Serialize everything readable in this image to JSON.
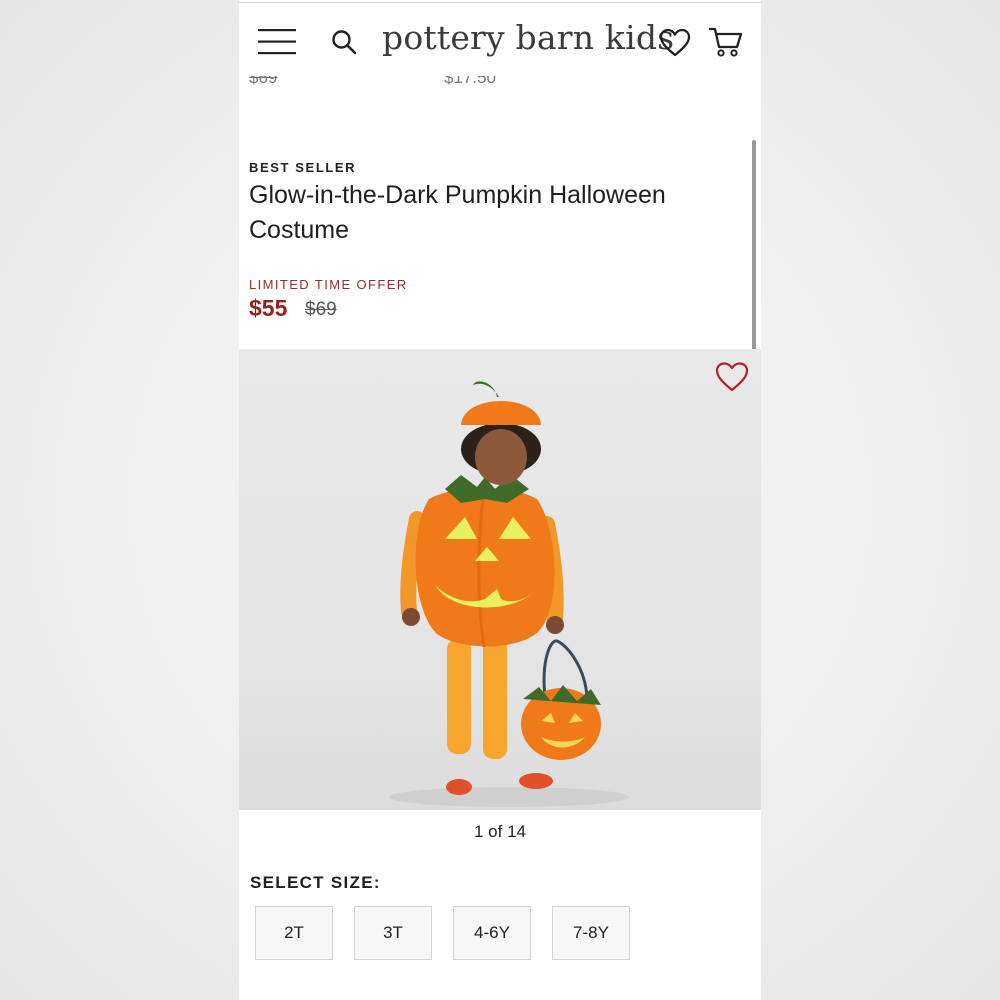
{
  "header": {
    "logo": "pottery barn kids",
    "icons": {
      "menu": "menu-icon",
      "search": "search-icon",
      "wishlist": "heart-icon",
      "cart": "cart-icon"
    }
  },
  "previous_row": {
    "price_left": "$69",
    "price_right": "$17.50"
  },
  "product": {
    "badge": "BEST SELLER",
    "title": "Glow-in-the-Dark Pumpkin Halloween Costume",
    "offer_label": "LIMITED TIME OFFER",
    "sale_price": "$55",
    "original_price": "$69",
    "image_counter": "1 of 14"
  },
  "sizes": {
    "label": "SELECT SIZE:",
    "options": [
      "2T",
      "3T",
      "4-6Y",
      "7-8Y"
    ]
  },
  "colors": {
    "sale_red": "#9b1c1c",
    "pumpkin_orange": "#f07a1a",
    "glow_yellow": "#e8f060"
  }
}
